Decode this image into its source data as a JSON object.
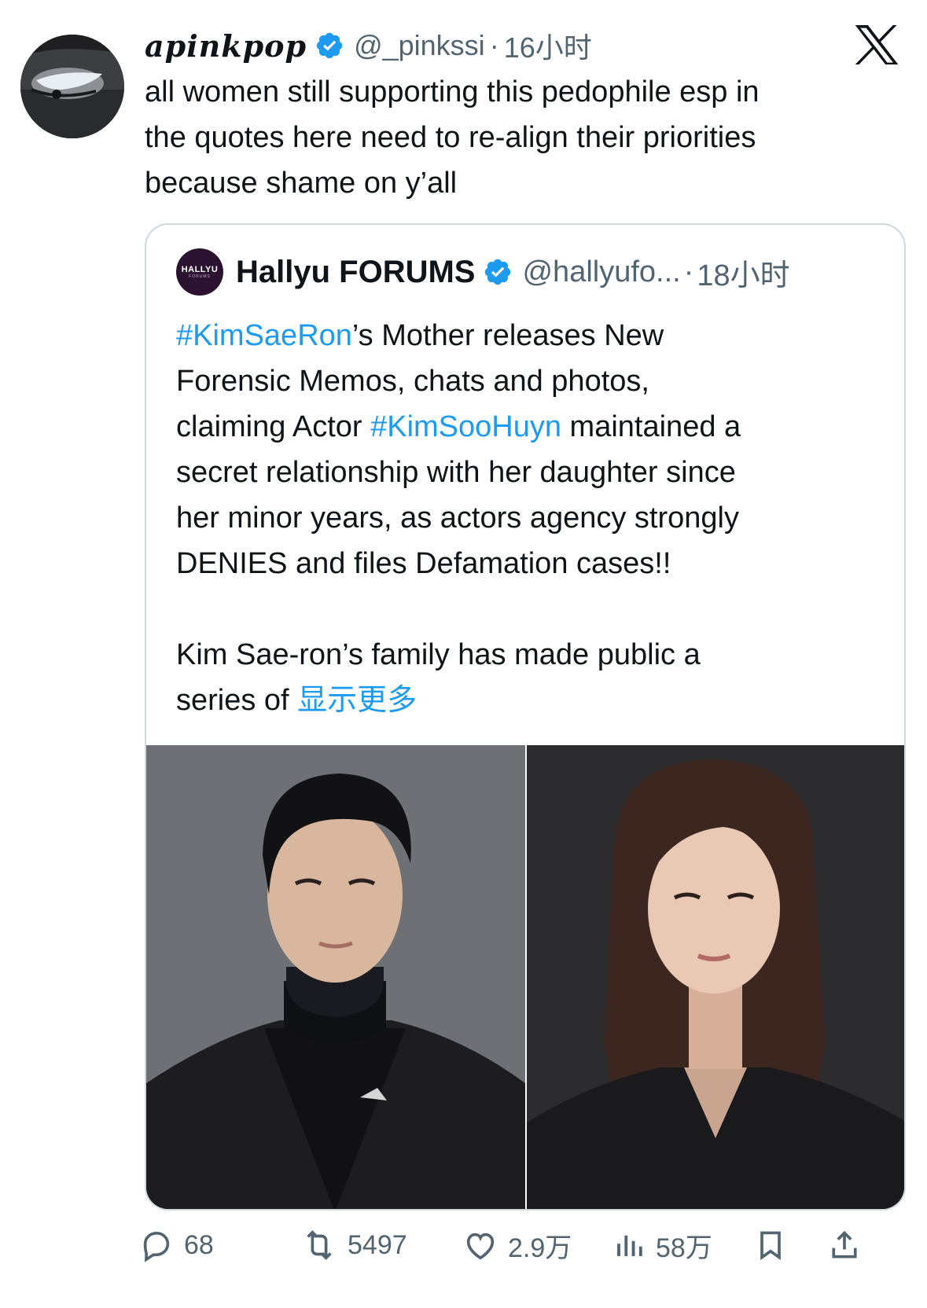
{
  "tweet": {
    "display_name": "apinkpop",
    "handle": "@_pinkssi",
    "separator": "·",
    "time": "16小时",
    "text_lines": [
      "all women still supporting this pedophile esp in",
      "the quotes here need to re-align their priorities",
      "because shame on y’all"
    ]
  },
  "quote": {
    "display_name": "Hallyu FORUMS",
    "handle": "@hallyufo...",
    "separator": "·",
    "time": "18小时",
    "logo_text": "HALLYU",
    "logo_subtext": "FORUMS",
    "line1_tag": "#KimSaeRon",
    "line1_rest": "’s Mother releases New",
    "line2": "Forensic Memos, chats and photos,",
    "line3_pre": "claiming Actor ",
    "line3_tag": "#KimSooHuyn",
    "line3_rest": " maintained a",
    "line4": "secret relationship with her daughter since",
    "line5": "her minor years, as actors agency strongly",
    "line6": "DENIES and files Defamation cases!!",
    "line7": "Kim Sae-ron’s family has made public a",
    "line8_pre": "series of ",
    "show_more": "显示更多"
  },
  "actions": {
    "replies": "68",
    "reposts": "5497",
    "likes": "2.9万",
    "views": "58万"
  },
  "icons": {
    "brand": "x-logo-icon",
    "verified": "verified-badge-icon",
    "reply": "reply-icon",
    "repost": "repost-icon",
    "like": "heart-icon",
    "views": "views-icon",
    "bookmark": "bookmark-icon",
    "share": "share-icon"
  },
  "colors": {
    "accent": "#1d9bf0",
    "text": "#0f1419",
    "muted": "#536471",
    "border": "#cfd9de"
  }
}
